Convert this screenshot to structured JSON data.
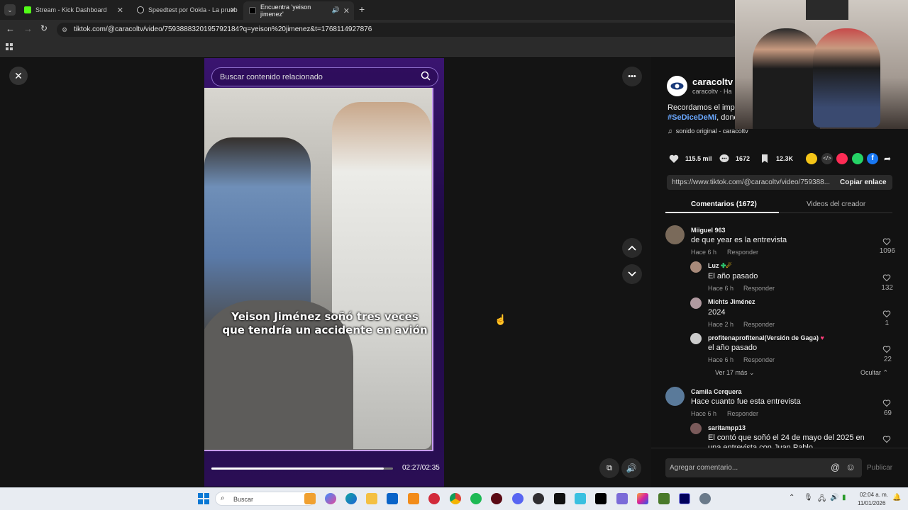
{
  "browser": {
    "tabs": [
      {
        "title": "Stream - Kick Dashboard",
        "color": "#53fc18"
      },
      {
        "title": "Speedtest por Ookla - La prueb",
        "color": "#8a8a8a"
      },
      {
        "title": "Encuentra 'yeison jimenez' ",
        "color": "#ffffff"
      }
    ],
    "url": "tiktok.com/@caracoltv/video/7593888320195792184?q=yeison%20jimenez&t=1768114927876"
  },
  "video": {
    "search_placeholder": "Buscar contenido relacionado",
    "caption_line1": "Yeison Jiménez soñó tres veces",
    "caption_line2": "que tendría un accidente en avión",
    "time": "02:27/02:35",
    "progress": 0.95
  },
  "panel": {
    "author": "caracoltv",
    "author_sub": "caracoltv · Ha",
    "description": "Recordamos el impa",
    "hashtag": "#SeDiceDeMí",
    "hashtag_rest": ", donc",
    "sound": "sonido original - caracoltv",
    "stats": {
      "likes": "115.5 mil",
      "comments": "1672",
      "saves": "12.3K"
    },
    "link": "https://www.tiktok.com/@caracoltv/video/759388...",
    "copy_label": "Copiar enlace",
    "tab_comments": "Comentarios (1672)",
    "tab_creator": "Videos del creador",
    "comments": [
      {
        "name": "Miiguel 963",
        "text": "de que year es la entrevista",
        "time": "Hace 6 h",
        "reply": "Responder",
        "likes": "1096"
      },
      {
        "name": "Luz ",
        "text": "El año pasado",
        "time": "Hace 6 h",
        "reply": "Responder",
        "likes": "132"
      },
      {
        "name": "Michts Jiménez",
        "text": "2024",
        "time": "Hace 2 h",
        "reply": "Responder",
        "likes": "1"
      },
      {
        "name": "profitenaprofitenal(Versión de Gaga)",
        "text": "el año pasado",
        "time": "Hace 6 h",
        "reply": "Responder",
        "likes": "22"
      },
      {
        "name": "Camila Cerquera",
        "text": "Hace cuanto fue esta entrevista",
        "time": "Hace 6 h",
        "reply": "Responder",
        "likes": "69"
      },
      {
        "name": "saritampp13",
        "text": "El contó que soñó el 24 de mayo del 2025 en",
        "text2": "una entrevista con Juan Pablo"
      }
    ],
    "view_more": "Ver 17 más",
    "hide": "Ocultar",
    "comment_placeholder": "Agregar comentario...",
    "publish": "Publicar"
  },
  "taskbar": {
    "search": "Buscar",
    "time": "02:04 a. m.",
    "date": "11/01/2026"
  }
}
